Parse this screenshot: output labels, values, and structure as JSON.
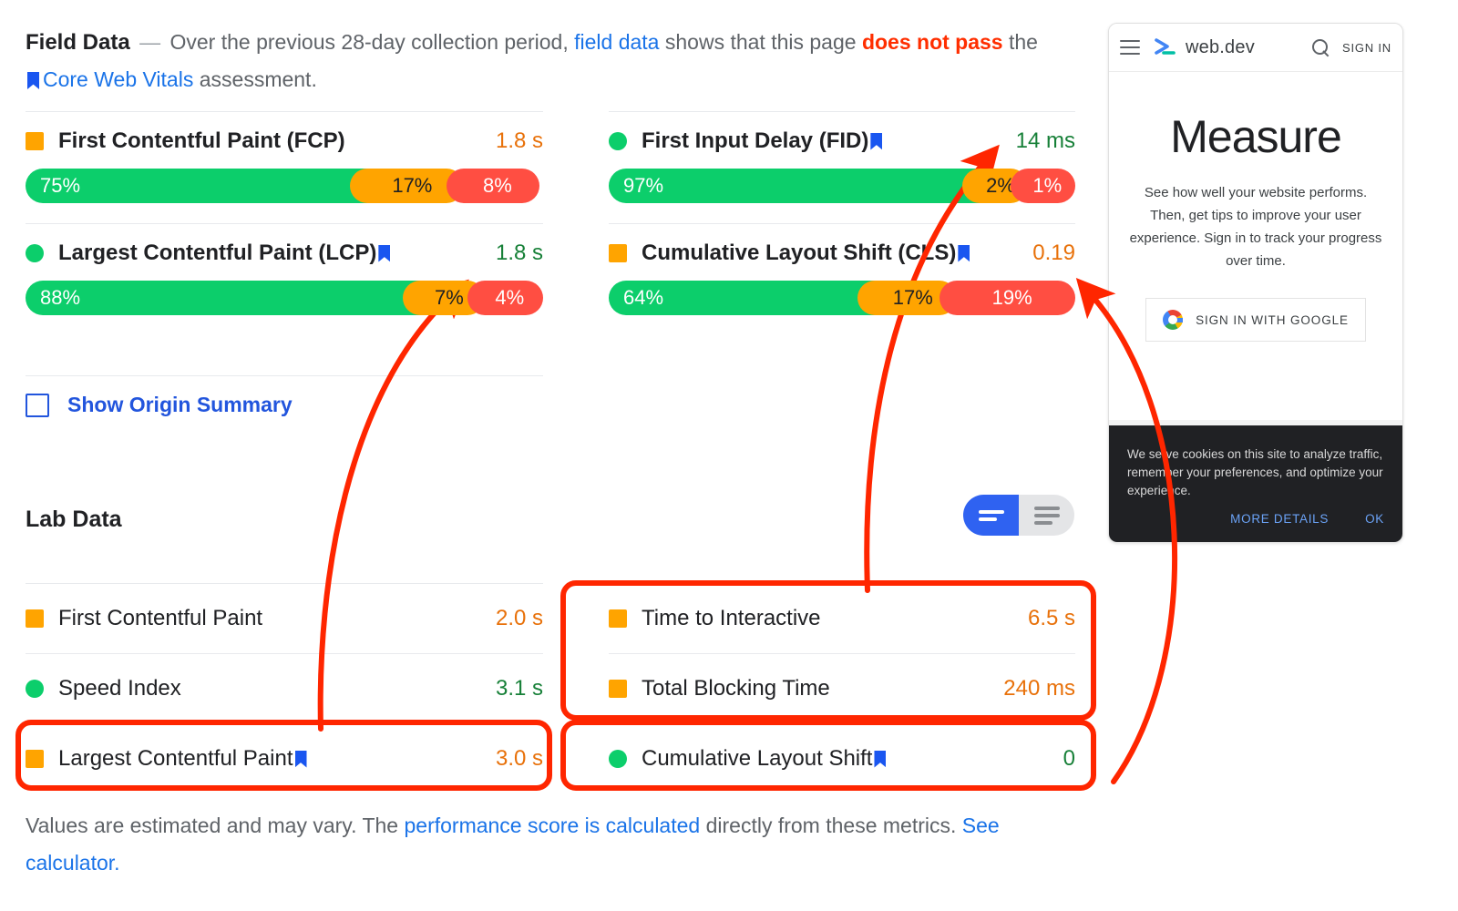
{
  "field": {
    "title": "Field Data",
    "dash": "—",
    "intro_1": "Over the previous 28-day collection period,",
    "link_field_data": "field data",
    "intro_2": "shows that this page",
    "fail": "does not pass",
    "intro_3": "the",
    "link_cwv": "Core Web Vitals",
    "intro_4": "assessment.",
    "metrics": [
      {
        "name": "First Contentful Paint (FCP)",
        "value": "1.8 s",
        "value_color": "orange",
        "indicator": "square",
        "bookmark": false,
        "good": "75%",
        "avg": "17%",
        "poor": "8%"
      },
      {
        "name": "First Input Delay (FID)",
        "value": "14 ms",
        "value_color": "green",
        "indicator": "circle",
        "bookmark": true,
        "good": "97%",
        "avg": "2%",
        "poor": "1%"
      },
      {
        "name": "Largest Contentful Paint (LCP)",
        "value": "1.8 s",
        "value_color": "green",
        "indicator": "circle",
        "bookmark": true,
        "good": "88%",
        "avg": "7%",
        "poor": "4%"
      },
      {
        "name": "Cumulative Layout Shift (CLS)",
        "value": "0.19",
        "value_color": "orange",
        "indicator": "square",
        "bookmark": true,
        "good": "64%",
        "avg": "17%",
        "poor": "19%"
      }
    ],
    "origin_summary_label": "Show Origin Summary",
    "origin_summary_checked": false
  },
  "lab": {
    "title": "Lab Data",
    "view_toggle": {
      "active": "compact-view",
      "options": [
        "compact-view",
        "list-view"
      ]
    },
    "metrics": [
      {
        "name": "First Contentful Paint",
        "value": "2.0 s",
        "value_color": "orange",
        "indicator": "square",
        "bookmark": false,
        "highlighted": false
      },
      {
        "name": "Time to Interactive",
        "value": "6.5 s",
        "value_color": "orange",
        "indicator": "square",
        "bookmark": false,
        "highlighted": true
      },
      {
        "name": "Speed Index",
        "value": "3.1 s",
        "value_color": "green",
        "indicator": "circle",
        "bookmark": false,
        "highlighted": false
      },
      {
        "name": "Total Blocking Time",
        "value": "240 ms",
        "value_color": "orange",
        "indicator": "square",
        "bookmark": false,
        "highlighted": true
      },
      {
        "name": "Largest Contentful Paint",
        "value": "3.0 s",
        "value_color": "orange",
        "indicator": "square",
        "bookmark": true,
        "highlighted": true
      },
      {
        "name": "Cumulative Layout Shift",
        "value": "0",
        "value_color": "green",
        "indicator": "circle",
        "bookmark": true,
        "highlighted": true
      }
    ]
  },
  "footer": {
    "text_1": "Values are estimated and may vary. The",
    "link_1": "performance score is calculated",
    "text_2": "directly from these metrics.",
    "link_2": "See calculator."
  },
  "phone": {
    "brand": "web.dev",
    "sign_in": "SIGN IN",
    "heading": "Measure",
    "description": "See how well your website performs. Then, get tips to improve your user experience. Sign in to track your progress over time.",
    "google_button": "SIGN IN WITH GOOGLE",
    "cookie_text": "We serve cookies on this site to analyze traffic, remember your preferences, and optimize your experience.",
    "cookie_more": "MORE DETAILS",
    "cookie_ok": "OK"
  },
  "annotations": {
    "color": "#ff2600",
    "arrow_count": 3,
    "box_count": 3
  },
  "colors": {
    "good": "#0cce6b",
    "average": "#ffa400",
    "poor": "#ff4e42",
    "link": "#1a73e8",
    "fail_text": "#ff2e00",
    "annotation": "#ff2600"
  }
}
